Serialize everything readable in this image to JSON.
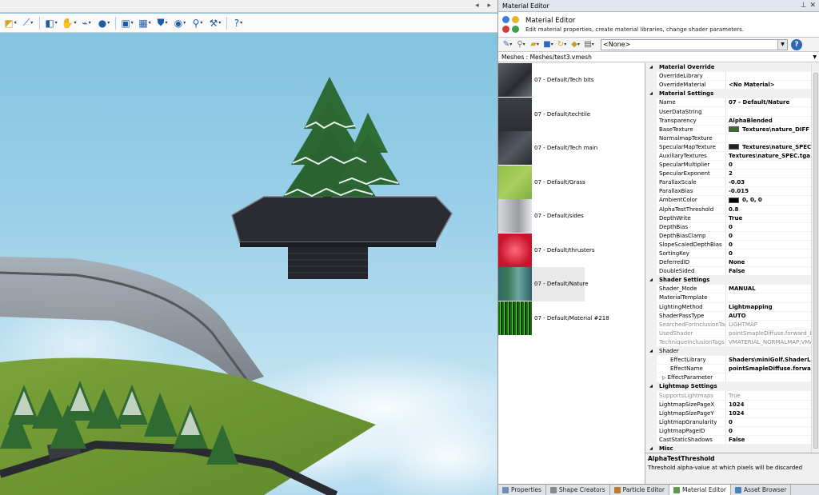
{
  "viewport": {
    "nav_arrows": "◂ ▸",
    "toolbar_icons": [
      "select-icon",
      "wand-icon",
      "move-icon",
      "hand-icon",
      "magnet-icon",
      "sphere-icon",
      "camera-icon",
      "shader-icon",
      "shield-icon",
      "display-icon",
      "zoom-icon",
      "wrench-icon",
      "help-icon"
    ]
  },
  "panel": {
    "title": "Material Editor",
    "header_title": "Material Editor",
    "header_subtitle": "Edit material properties, create material libraries, change shader parameters.",
    "library_select": "<None>",
    "mesh_path": "Meshes : Meshes/test3.vmesh"
  },
  "materials": [
    {
      "label": "07 - Default/Tech bits",
      "thumb": "techbits"
    },
    {
      "label": "07 - Default/techtile",
      "thumb": "techtile"
    },
    {
      "label": "07 - Default/Tech main",
      "thumb": "techmain"
    },
    {
      "label": "07 - Default/Grass",
      "thumb": "grass"
    },
    {
      "label": "07 - Default/sides",
      "thumb": "sides"
    },
    {
      "label": "07 - Default/thrusters",
      "thumb": "thrusters"
    },
    {
      "label": "07 - Default/Nature",
      "thumb": "nature",
      "selected": true
    },
    {
      "label": "07 - Default/Material #218",
      "thumb": "material218"
    }
  ],
  "properties": [
    {
      "type": "cat",
      "name": "Material Override"
    },
    {
      "name": "OverrideLibrary",
      "value": ""
    },
    {
      "name": "OverrideMaterial",
      "value": "<No Material>"
    },
    {
      "type": "cat",
      "name": "Material Settings"
    },
    {
      "name": "Name",
      "value": "07 - Default/Nature"
    },
    {
      "name": "UserDataString",
      "value": ""
    },
    {
      "name": "Transparency",
      "value": "AlphaBlended"
    },
    {
      "name": "BaseTexture",
      "value": "Textures\\nature_DIFF",
      "swatch": "#3d6b2b"
    },
    {
      "name": "NormalmapTexture",
      "value": ""
    },
    {
      "name": "SpecularMapTexture",
      "value": "Textures\\nature_SPEC",
      "swatch": "#222222"
    },
    {
      "name": "AuxiliaryTextures",
      "value": "Textures\\nature_SPEC.tga"
    },
    {
      "name": "SpecularMultiplier",
      "value": "0"
    },
    {
      "name": "SpecularExponent",
      "value": "2"
    },
    {
      "name": "ParallaxScale",
      "value": "-0.03"
    },
    {
      "name": "ParallaxBias",
      "value": "-0.015"
    },
    {
      "name": "AmbientColor",
      "value": "0, 0, 0",
      "swatch": "#000000"
    },
    {
      "name": "AlphaTestThreshold",
      "value": "0.8"
    },
    {
      "name": "DepthWrite",
      "value": "True"
    },
    {
      "name": "DepthBias",
      "value": "0"
    },
    {
      "name": "DepthBiasClamp",
      "value": "0"
    },
    {
      "name": "SlopeScaledDepthBias",
      "value": "0"
    },
    {
      "name": "SortingKey",
      "value": "0"
    },
    {
      "name": "DeferredID",
      "value": "None"
    },
    {
      "name": "DoubleSided",
      "value": "False"
    },
    {
      "type": "cat",
      "name": "Shader Settings"
    },
    {
      "name": "Shader_Mode",
      "value": "MANUAL"
    },
    {
      "name": "MaterialTemplate",
      "value": ""
    },
    {
      "name": "LightingMethod",
      "value": "Lightmapping"
    },
    {
      "name": "ShaderPassType",
      "value": "AUTO"
    },
    {
      "name": "SearchedForInclusionTag",
      "value": "LIGHTMAP",
      "dim": true
    },
    {
      "name": "UsedShader",
      "value": "pointSmapleDiffuse.forward_Lig",
      "dim": true
    },
    {
      "name": "TechniqueInclusionTags",
      "value": "VMATERIAL_NORMALMAP;VMAT",
      "dim": true
    },
    {
      "type": "cat",
      "name": "Shader",
      "plain": true
    },
    {
      "name": "EffectLibrary",
      "value": "Shaders\\miniGolf.ShaderLib",
      "sub": true
    },
    {
      "name": "EffectName",
      "value": "pointSmapleDiffuse.forward",
      "sub": true
    },
    {
      "name": "EffectParameter",
      "value": "",
      "sub": true,
      "expander": "▷"
    },
    {
      "type": "cat",
      "name": "Lightmap Settings"
    },
    {
      "name": "SupportsLightmaps",
      "value": "True",
      "dim": true
    },
    {
      "name": "LightmapSizePageX",
      "value": "1024"
    },
    {
      "name": "LightmapSizePageY",
      "value": "1024"
    },
    {
      "name": "LightmapGranularity",
      "value": "0"
    },
    {
      "name": "LightmapPageID",
      "value": "0"
    },
    {
      "name": "CastStaticShadows",
      "value": "False"
    },
    {
      "type": "cat",
      "name": "Misc"
    }
  ],
  "description": {
    "title": "AlphaTestThreshold",
    "text": "Threshold alpha-value at which pixels will be discarded"
  },
  "tabs": [
    {
      "label": "Properties",
      "icon": "properties-icon",
      "color": "#6f8fb6"
    },
    {
      "label": "Shape Creators",
      "icon": "shape-creators-icon",
      "color": "#8a8a8a"
    },
    {
      "label": "Particle Editor",
      "icon": "particle-editor-icon",
      "color": "#c0782c"
    },
    {
      "label": "Material Editor",
      "icon": "material-editor-icon",
      "color": "#5a9a48",
      "active": true
    },
    {
      "label": "Asset Browser",
      "icon": "asset-browser-icon",
      "color": "#4a7ec0"
    }
  ]
}
